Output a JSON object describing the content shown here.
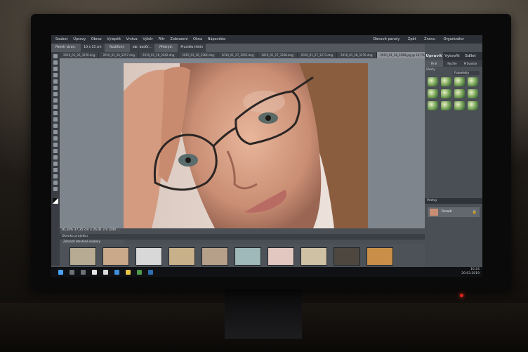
{
  "menu": [
    "Soubor",
    "Úpravy",
    "Obraz",
    "Vylepšit",
    "Vrstva",
    "Výběr",
    "Filtr",
    "Zobrazení",
    "Okna",
    "Nápověda"
  ],
  "menu_right": [
    "Obnovit panely",
    "Zpět",
    "Znovu",
    "Organizátor"
  ],
  "options": {
    "label1": "Poměr stran:",
    "value1": "10 x 15 cm",
    "label2": "Rozlišení:",
    "value2": "obr. bodů/...",
    "label3": "Překrytí:",
    "value3": "Pravidlo třetin"
  },
  "doc_tabs": [
    "2010_01_26_3250.dng",
    "2010_01_26_3257.dng",
    "2010_01_26_3262.dng",
    "2010_01_26_3264.dng",
    "2010_01_27_3265.dng",
    "2010_01_27_3268.dng",
    "2010_01_27_3273.dng",
    "2010_01_28_3276.dng",
    "2010_01_28_3299.jpg @ 16,7% (RGB/8)"
  ],
  "active_tab_index": 8,
  "status": "16,34%   37,35 cm x 26,41 cm (240 ...",
  "bin_title": "Okenko projektu",
  "bin_select": "Zobrazit otevřené soubory",
  "thumb_colors": [
    "#b8ab93",
    "#c9a98a",
    "#d8d8d8",
    "#c8b08a",
    "#b7a08a",
    "#9fb8b9",
    "#e1c7c0",
    "#cfc2a4",
    "#4d4740",
    "#c98f48"
  ],
  "panel": {
    "tabs": [
      "Upravit",
      "Vytvořit",
      "Sdílet"
    ],
    "subtabs": [
      "Plně",
      "Rychle",
      "Průvodce"
    ],
    "section": "Efekty",
    "effects_select": "Fotoefekty",
    "layers_title": "Vrstvy",
    "layer_name": "Pozadí"
  },
  "clock": {
    "time": "16:24",
    "date": "20.03.2019"
  },
  "colors": {
    "screen": "#4a4f56",
    "canvas": "#7f858d",
    "led": "#e2231a"
  }
}
